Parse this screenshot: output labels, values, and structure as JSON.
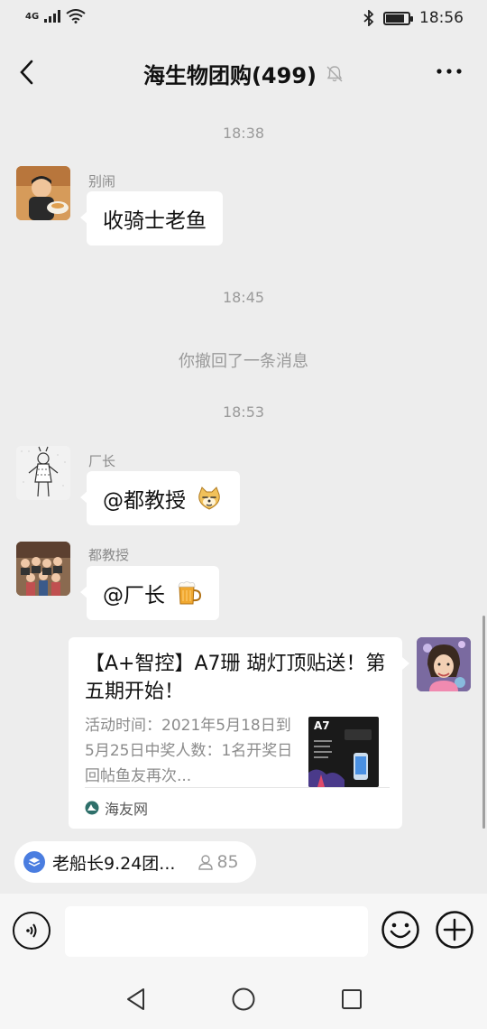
{
  "status_bar": {
    "network": "4G",
    "time": "18:56",
    "battery_level": 0.85
  },
  "header": {
    "title": "海生物团购(499)",
    "muted": true
  },
  "messages": {
    "t1": "18:38",
    "m1": {
      "sender": "别闹",
      "text": "收骑士老鱼"
    },
    "t2": "18:45",
    "recall": "你撤回了一条消息",
    "t3": "18:53",
    "m2": {
      "sender": "厂长",
      "text": "@都教授"
    },
    "m3": {
      "sender": "都教授",
      "text": "@厂长"
    },
    "card": {
      "title": "【A+智控】A7珊 瑚灯顶贴送！第五期开始！",
      "desc": "活动时间：2021年5月18日到5月25日中奖人数：1名开奖日回帖鱼友再次...",
      "thumb_label": "A7",
      "source": "海友网"
    }
  },
  "pinned": {
    "label": "老船长9.24团...",
    "count": "85"
  },
  "input": {
    "placeholder": ""
  },
  "colors": {
    "background": "#ededed",
    "bubble": "#ffffff",
    "meta_text": "#9a9a9a"
  }
}
